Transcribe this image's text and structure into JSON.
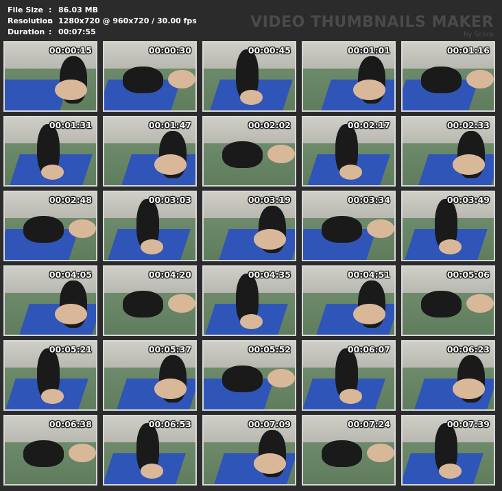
{
  "info": {
    "file_size_label": "File Size",
    "file_size_value": "86.03 MB",
    "resolution_label": "Resolution",
    "resolution_value": "1280x720 @ 960x720 / 30.00 fps",
    "duration_label": "Duration",
    "duration_value": "00:07:55",
    "separator": ":"
  },
  "brand": {
    "title": "VIDEO THUMBNAILS MAKER",
    "subtitle": "by Scorp"
  },
  "thumbnails": [
    "00:00:15",
    "00:00:30",
    "00:00:45",
    "00:01:01",
    "00:01:16",
    "00:01:31",
    "00:01:47",
    "00:02:02",
    "00:02:17",
    "00:02:33",
    "00:02:48",
    "00:03:03",
    "00:03:19",
    "00:03:34",
    "00:03:49",
    "00:04:05",
    "00:04:20",
    "00:04:35",
    "00:04:51",
    "00:05:06",
    "00:05:21",
    "00:05:37",
    "00:05:52",
    "00:06:07",
    "00:06:23",
    "00:06:38",
    "00:06:53",
    "00:07:09",
    "00:07:24",
    "00:07:39"
  ],
  "colors": {
    "background": "#2b2b2b",
    "thumb_border": "#d8d8d8",
    "mat_blue": "#2f55b8",
    "floor_green": "#6d8a6a",
    "brand_text": "#4a4a4a"
  }
}
